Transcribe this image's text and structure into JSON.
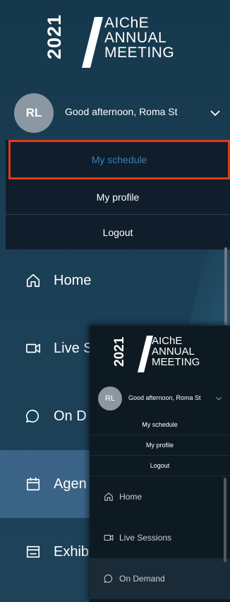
{
  "brand": {
    "year": "2021",
    "line1": "AIChE",
    "line2": "ANNUAL",
    "line3": "MEETING"
  },
  "user": {
    "initials": "RL",
    "greeting": "Good afternoon, Roma St"
  },
  "menu": {
    "items": [
      {
        "label": "My schedule",
        "active": true
      },
      {
        "label": "My profile"
      },
      {
        "label": "Logout"
      }
    ]
  },
  "nav": {
    "items": [
      {
        "label": "Home",
        "icon": "home-icon"
      },
      {
        "label": "Live S",
        "icon": "video-camera-icon"
      },
      {
        "label": "On D",
        "icon": "chat-bubble-icon"
      },
      {
        "label": "Agen",
        "icon": "calendar-icon",
        "active": true
      },
      {
        "label": "Exhib",
        "icon": "booth-icon"
      }
    ]
  },
  "inset": {
    "user": {
      "initials": "RL",
      "greeting": "Good afternoon, Roma St"
    },
    "menu": [
      "My schedule",
      "My profile",
      "Logout"
    ],
    "nav": [
      {
        "label": "Home",
        "icon": "home-icon"
      },
      {
        "label": "Live Sessions",
        "icon": "video-camera-icon"
      },
      {
        "label": "On Demand",
        "icon": "chat-bubble-icon"
      }
    ]
  },
  "colors": {
    "highlight_border": "#e03a1a",
    "active_link": "#3a7fb7",
    "active_nav_bg": "#3b6386"
  }
}
